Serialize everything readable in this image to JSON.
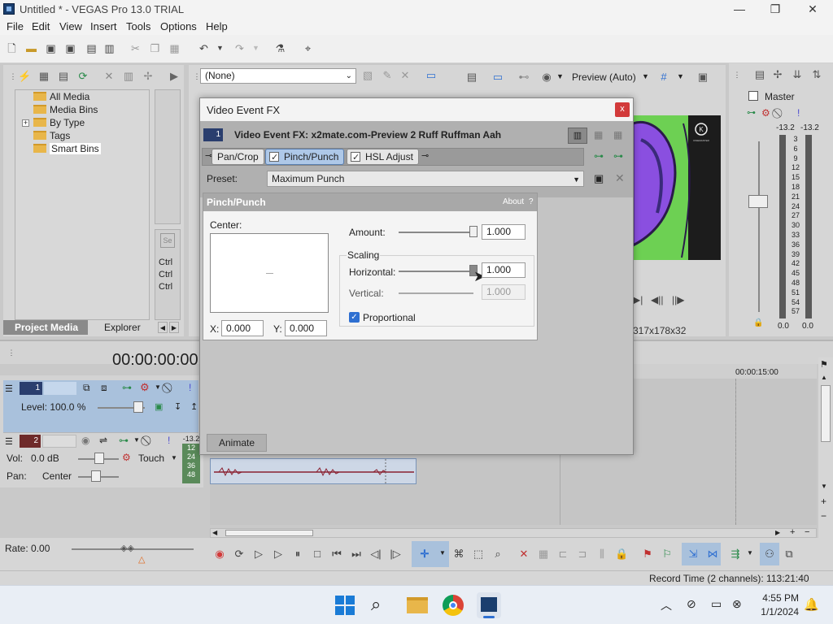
{
  "window": {
    "title": "Untitled * - VEGAS Pro 13.0 TRIAL"
  },
  "menu": [
    "File",
    "Edit",
    "View",
    "Insert",
    "Tools",
    "Options",
    "Help"
  ],
  "preview_toolbar": {
    "none_select": "(None)",
    "preview_quality": "Preview (Auto)"
  },
  "project_media": {
    "tree": [
      "All Media",
      "Media Bins",
      "By Type",
      "Tags",
      "Smart Bins"
    ],
    "ctrl_labels": [
      "Ctrl",
      "Ctrl",
      "Ctrl"
    ],
    "tabs": [
      "Project Media",
      "Explorer"
    ]
  },
  "preview": {
    "frame_info": "317x178x32",
    "logo_text": "KINEMASTER"
  },
  "master": {
    "title": "Master",
    "peak_left": "-13.2",
    "peak_right": "-13.2",
    "scale": [
      "3",
      "6",
      "9",
      "12",
      "15",
      "18",
      "21",
      "24",
      "27",
      "30",
      "33",
      "36",
      "39",
      "42",
      "45",
      "48",
      "51",
      "54",
      "57"
    ],
    "bottom_left": "0.0",
    "bottom_right": "0.0"
  },
  "timeline": {
    "timecode": "00:00:00:00",
    "ruler_marker": "00:00:15:00",
    "video_track": {
      "number": "1",
      "level": "Level: 100.0 %"
    },
    "audio_track": {
      "number": "2",
      "vol_label": "Vol:",
      "vol_value": "0.0 dB",
      "pan_label": "Pan:",
      "pan_value": "Center",
      "automation": "Touch",
      "meter_top": "-13.2",
      "meter_scale": [
        "12",
        "24",
        "36",
        "48"
      ]
    },
    "rate": "Rate: 0.00"
  },
  "status": {
    "record_time": "Record Time (2 channels): 113:21:40"
  },
  "dialog": {
    "title": "Video Event FX",
    "close_label": "x",
    "track_number": "1",
    "header_text": "Video Event FX:  x2mate.com-Preview 2 Ruff Ruffman Aah",
    "chain": [
      "Pan/Crop",
      "Pinch/Punch",
      "HSL Adjust"
    ],
    "preset_label": "Preset:",
    "preset_value": "Maximum Punch",
    "animate_label": "Animate",
    "plugin": {
      "name": "Pinch/Punch",
      "about": "About",
      "help": "?",
      "center_label": "Center:",
      "x_label": "X:",
      "x_value": "0.000",
      "y_label": "Y:",
      "y_value": "0.000",
      "amount_label": "Amount:",
      "amount_value": "1.000",
      "scaling_label": "Scaling",
      "horizontal_label": "Horizontal:",
      "horizontal_value": "1.000",
      "vertical_label": "Vertical:",
      "vertical_value": "1.000",
      "proportional_label": "Proportional",
      "proportional_checked": true
    }
  },
  "taskbar": {
    "time": "4:55 PM",
    "date": "1/1/2024"
  },
  "colors": {
    "accent": "#2e6fd1",
    "selected_track": "#a9c1dc",
    "record_red": "#d23a3a",
    "preview_green": "#6dd053",
    "preview_purple": "#8a4fe0"
  }
}
